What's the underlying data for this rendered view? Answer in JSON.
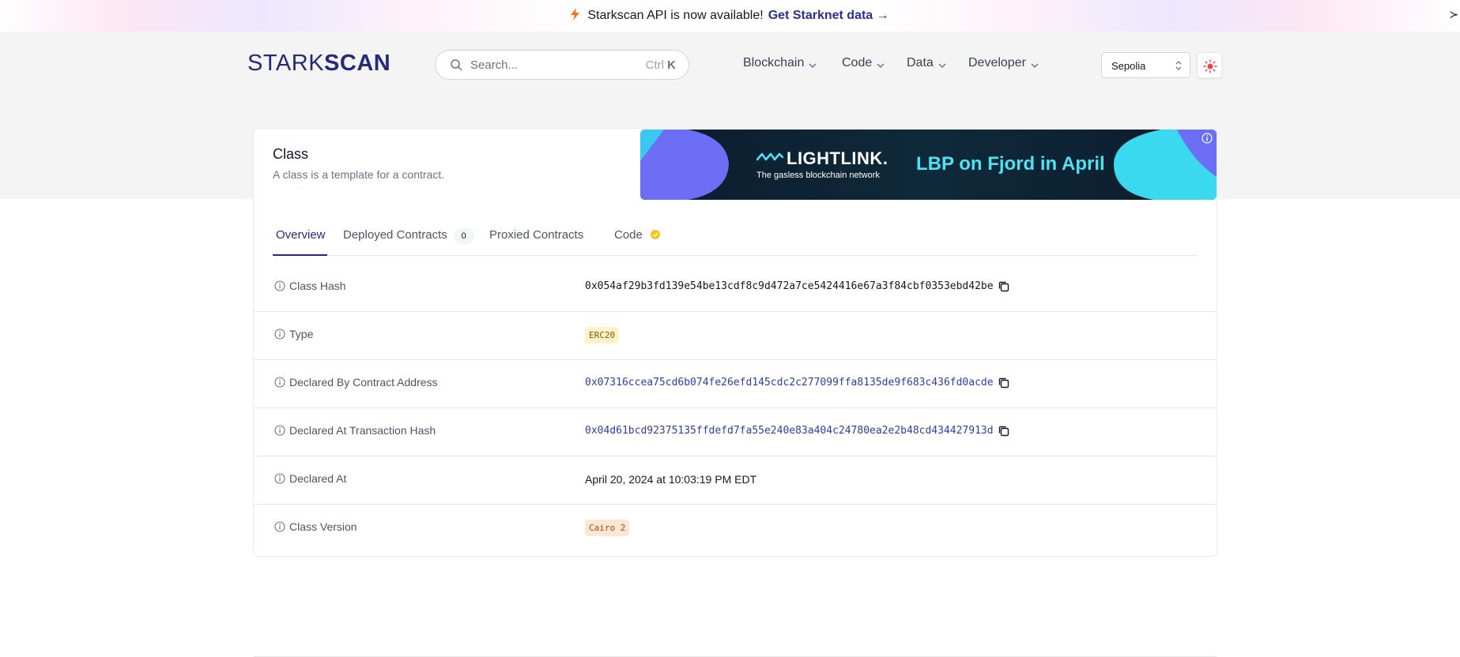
{
  "announcement": {
    "text": "Starkscan API is now available!",
    "link": "Get Starknet data →",
    "edge_glyph": "≻"
  },
  "header": {
    "logo_light": "STARK",
    "logo_bold": "SCAN",
    "search_placeholder": "Search...",
    "search_shortcut_mod": "Ctrl",
    "search_shortcut_key": "K",
    "nav": {
      "blockchain": "Blockchain",
      "code": "Code",
      "data": "Data",
      "developer": "Developer"
    },
    "network": "Sepolia"
  },
  "card": {
    "title": "Class",
    "subtitle": "A class is a template for a contract."
  },
  "ad": {
    "brand": "LIGHTLINK.",
    "tagline": "The gasless blockchain network",
    "headline": "LBP on Fjord in April"
  },
  "tabs": {
    "overview": "Overview",
    "deployed": "Deployed Contracts",
    "deployed_count": "0",
    "proxied": "Proxied Contracts",
    "code": "Code"
  },
  "rows": {
    "class_hash": {
      "label": "Class Hash",
      "value": "0x054af29b3fd139e54be13cdf8c9d472a7ce5424416e67a3f84cbf0353ebd42be"
    },
    "type": {
      "label": "Type",
      "value": "ERC20"
    },
    "declared_by": {
      "label": "Declared By Contract Address",
      "value": "0x07316ccea75cd6b074fe26efd145cdc2c277099ffa8135de9f683c436fd0acde"
    },
    "declared_tx": {
      "label": "Declared At Transaction Hash",
      "value": "0x04d61bcd92375135ffdefd7fa55e240e83a404c24780ea2e2b48cd434427913d"
    },
    "declared_at": {
      "label": "Declared At",
      "value": "April 20, 2024 at 10:03:19 PM EDT"
    },
    "class_version": {
      "label": "Class Version",
      "value": "Cairo 2"
    }
  },
  "colors": {
    "brand": "#272a7a",
    "link": "#2f3da8",
    "accent_orange": "#f97316",
    "ad_teal": "#4ee3f2"
  }
}
